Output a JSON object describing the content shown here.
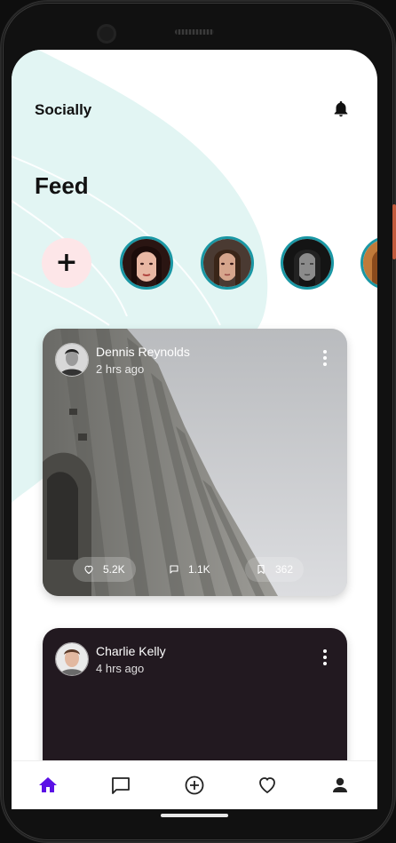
{
  "app": {
    "title": "Socially"
  },
  "feed": {
    "title": "Feed"
  },
  "stories": {
    "add_label": "+",
    "items": [
      {
        "name": "story-1"
      },
      {
        "name": "story-2"
      },
      {
        "name": "story-3"
      },
      {
        "name": "story-4"
      }
    ]
  },
  "posts": [
    {
      "user": "Dennis Reynolds",
      "time": "2 hrs ago",
      "likes": "5.2K",
      "comments": "1.1K",
      "saves": "362"
    },
    {
      "user": "Charlie Kelly",
      "time": "4 hrs ago"
    }
  ],
  "nav": {
    "items": [
      "home-icon",
      "chat-icon",
      "add-icon",
      "heart-icon",
      "profile-icon"
    ],
    "active": "home-icon"
  },
  "colors": {
    "accent": "#5b10e6",
    "story_ring": "#1a97a4",
    "bg_shape": "#e2f5f3",
    "add_story_bg": "#fde6e8"
  }
}
